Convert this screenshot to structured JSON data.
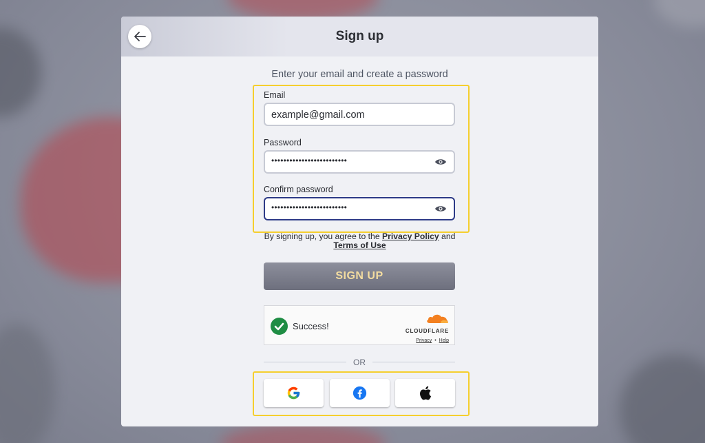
{
  "header": {
    "title": "Sign up"
  },
  "form": {
    "subtitle": "Enter your email and create a password",
    "email": {
      "label": "Email",
      "value": "example@gmail.com"
    },
    "password": {
      "label": "Password",
      "value": "•••••••••••••••••••••••••"
    },
    "confirm_password": {
      "label": "Confirm password",
      "value": "•••••••••••••••••••••••••"
    }
  },
  "terms": {
    "prefix": "By signing up, you agree to the ",
    "privacy_link": "Privacy Policy",
    "middle": " and",
    "terms_link": "Terms of Use"
  },
  "signup_button": {
    "label": "SIGN UP"
  },
  "captcha": {
    "status": "Success!",
    "brand": "CLOUDFLARE",
    "privacy": "Privacy",
    "separator": "•",
    "help": "Help"
  },
  "divider": {
    "label": "OR"
  },
  "social": {
    "icons": [
      "google-icon",
      "facebook-icon",
      "apple-icon"
    ]
  },
  "colors": {
    "highlight": "#f5cf2e",
    "button_text": "#f3dca0",
    "success_green": "#1f8d44",
    "facebook_blue": "#1877f2",
    "cloudflare_orange": "#f38020"
  }
}
